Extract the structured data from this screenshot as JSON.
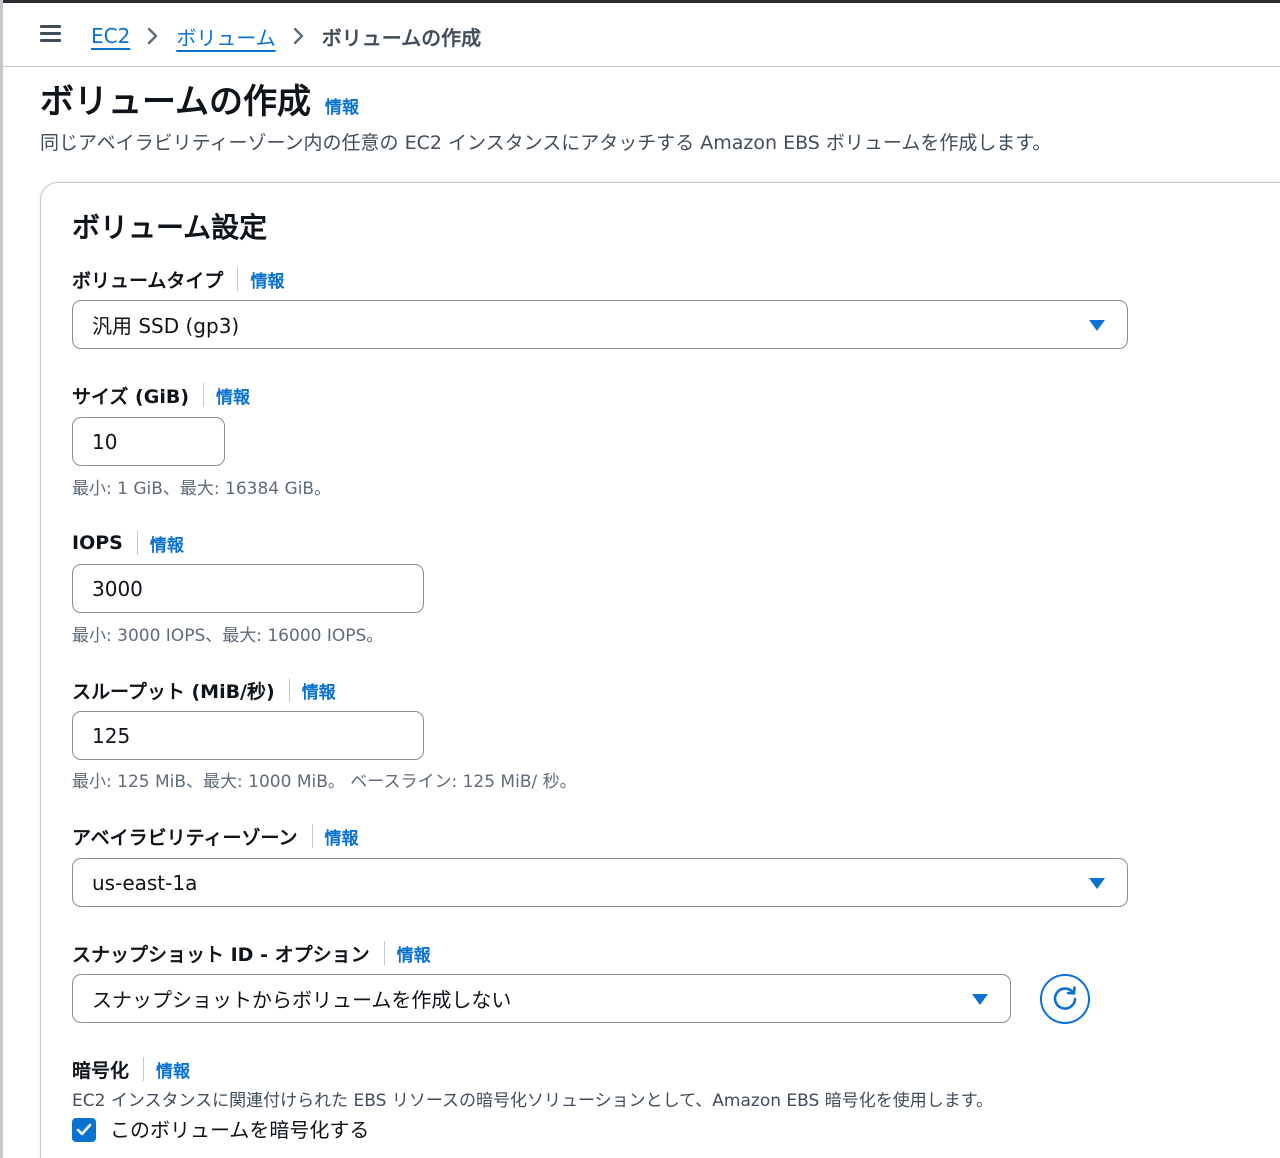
{
  "breadcrumb": {
    "items": [
      "EC2",
      "ボリューム"
    ],
    "current": "ボリュームの作成"
  },
  "page": {
    "title": "ボリュームの作成",
    "info": "情報",
    "description": "同じアベイラビリティーゾーン内の任意の EC2 インスタンスにアタッチする Amazon EBS ボリュームを作成します。"
  },
  "volume_settings": {
    "title": "ボリューム設定",
    "volume_type": {
      "label": "ボリュームタイプ",
      "info": "情報",
      "value": "汎用 SSD (gp3)"
    },
    "size": {
      "label": "サイズ (GiB)",
      "info": "情報",
      "value": "10",
      "hint": "最小: 1 GiB、最大: 16384 GiB。"
    },
    "iops": {
      "label": "IOPS",
      "info": "情報",
      "value": "3000",
      "hint": "最小: 3000 IOPS、最大: 16000 IOPS。"
    },
    "throughput": {
      "label": "スループット (MiB/秒)",
      "info": "情報",
      "value": "125",
      "hint": "最小: 125 MiB、最大: 1000 MiB。 ベースライン: 125 MiB/ 秒。"
    },
    "availability_zone": {
      "label": "アベイラビリティーゾーン",
      "info": "情報",
      "value": "us-east-1a"
    },
    "snapshot": {
      "label": "スナップショット ID - オプション",
      "info": "情報",
      "value": "スナップショットからボリュームを作成しない"
    },
    "encryption": {
      "label": "暗号化",
      "info": "情報",
      "description": "EC2 インスタンスに関連付けられた EBS リソースの暗号化ソリューションとして、Amazon EBS 暗号化を使用します。",
      "checkbox_label": "このボリュームを暗号化する",
      "checked": true
    }
  },
  "icons": {
    "menu": "hamburger-menu-icon",
    "breadcrumb_separator": "chevron-right-icon",
    "dropdown": "caret-down-icon",
    "refresh": "refresh-icon",
    "checkbox": "checkmark-icon"
  },
  "colors": {
    "link": "#0972d3",
    "text": "#0f141a",
    "muted": "#5f6b7a",
    "border": "#8c8c94"
  }
}
